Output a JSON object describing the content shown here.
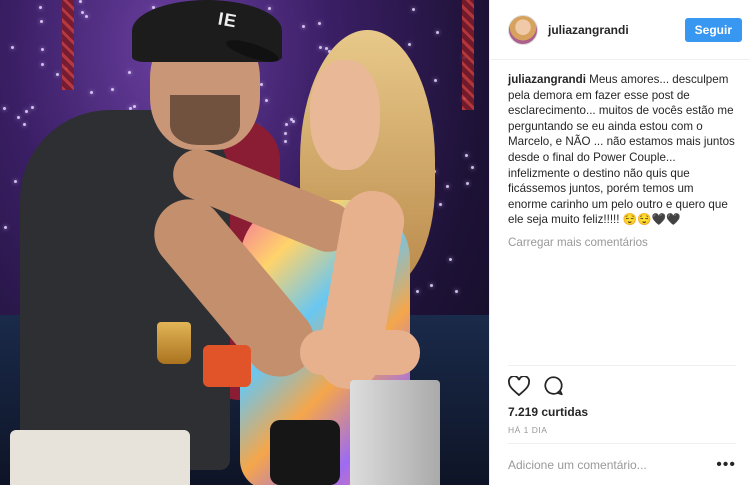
{
  "header": {
    "username": "juliazangrandi",
    "follow_label": "Seguir"
  },
  "photo": {
    "cap_text": "IE"
  },
  "caption": {
    "username": "juliazangrandi",
    "text": " Meus amores... desculpem pela demora em fazer esse post de esclarecimento... muitos de vocês estão me perguntando se eu ainda estou com o Marcelo, e NÃO ... não estamos mais juntos desde o final do Power Couple... infelizmente o destino não quis que ficássemos juntos, porém temos um enorme carinho um pelo outro e quero que ele seja muito feliz!!!!! 😌😌🖤🖤"
  },
  "load_more": "Carregar mais comentários",
  "actions": {
    "like_icon": "heart-icon",
    "comment_icon": "comment-icon"
  },
  "likes": "7.219 curtidas",
  "date": "HÁ 1 DIA",
  "add_comment": {
    "placeholder": "Adicione um comentário...",
    "more_icon": "more-options-icon"
  }
}
